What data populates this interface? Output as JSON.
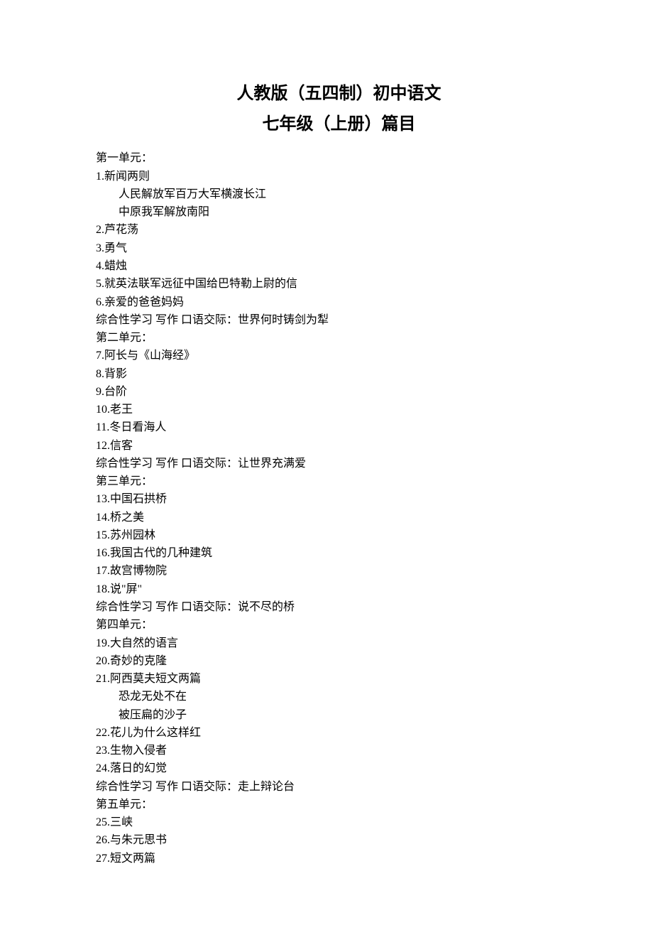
{
  "title1": "人教版（五四制）初中语文",
  "title2": "七年级（上册）篇目",
  "lines": [
    {
      "text": "第一单元：",
      "indent": false
    },
    {
      "text": "1.新闻两则",
      "indent": false
    },
    {
      "text": "人民解放军百万大军横渡长江",
      "indent": true
    },
    {
      "text": "中原我军解放南阳",
      "indent": true
    },
    {
      "text": "2.芦花荡",
      "indent": false
    },
    {
      "text": "3.勇气",
      "indent": false
    },
    {
      "text": "4.蜡烛",
      "indent": false
    },
    {
      "text": "5.就英法联军远征中国给巴特勒上尉的信",
      "indent": false
    },
    {
      "text": "6.亲爱的爸爸妈妈",
      "indent": false
    },
    {
      "text": "综合性学习 写作 口语交际：世界何时铸剑为犁",
      "indent": false
    },
    {
      "text": "第二单元：",
      "indent": false
    },
    {
      "text": "7.阿长与《山海经》",
      "indent": false
    },
    {
      "text": "8.背影",
      "indent": false
    },
    {
      "text": "9.台阶",
      "indent": false
    },
    {
      "text": "10.老王",
      "indent": false
    },
    {
      "text": "11.冬日看海人",
      "indent": false
    },
    {
      "text": "12.信客",
      "indent": false
    },
    {
      "text": "综合性学习 写作 口语交际：让世界充满爱",
      "indent": false
    },
    {
      "text": "第三单元：",
      "indent": false
    },
    {
      "text": "13.中国石拱桥",
      "indent": false
    },
    {
      "text": "14.桥之美",
      "indent": false
    },
    {
      "text": "15.苏州园林",
      "indent": false
    },
    {
      "text": "16.我国古代的几种建筑",
      "indent": false
    },
    {
      "text": "17.故宫博物院",
      "indent": false
    },
    {
      "text": "18.说\"屏\"",
      "indent": false
    },
    {
      "text": "综合性学习 写作 口语交际：说不尽的桥",
      "indent": false
    },
    {
      "text": "第四单元：",
      "indent": false
    },
    {
      "text": "19.大自然的语言",
      "indent": false
    },
    {
      "text": "20.奇妙的克隆",
      "indent": false
    },
    {
      "text": "21.阿西莫夫短文两篇",
      "indent": false
    },
    {
      "text": "恐龙无处不在",
      "indent": true
    },
    {
      "text": "被压扁的沙子",
      "indent": true
    },
    {
      "text": "22.花儿为什么这样红",
      "indent": false
    },
    {
      "text": "23.生物入侵者",
      "indent": false
    },
    {
      "text": "24.落日的幻觉",
      "indent": false
    },
    {
      "text": "综合性学习 写作 口语交际：走上辩论台",
      "indent": false
    },
    {
      "text": "第五单元：",
      "indent": false
    },
    {
      "text": "25.三峡",
      "indent": false
    },
    {
      "text": "26.与朱元思书",
      "indent": false
    },
    {
      "text": "27.短文两篇",
      "indent": false
    }
  ]
}
